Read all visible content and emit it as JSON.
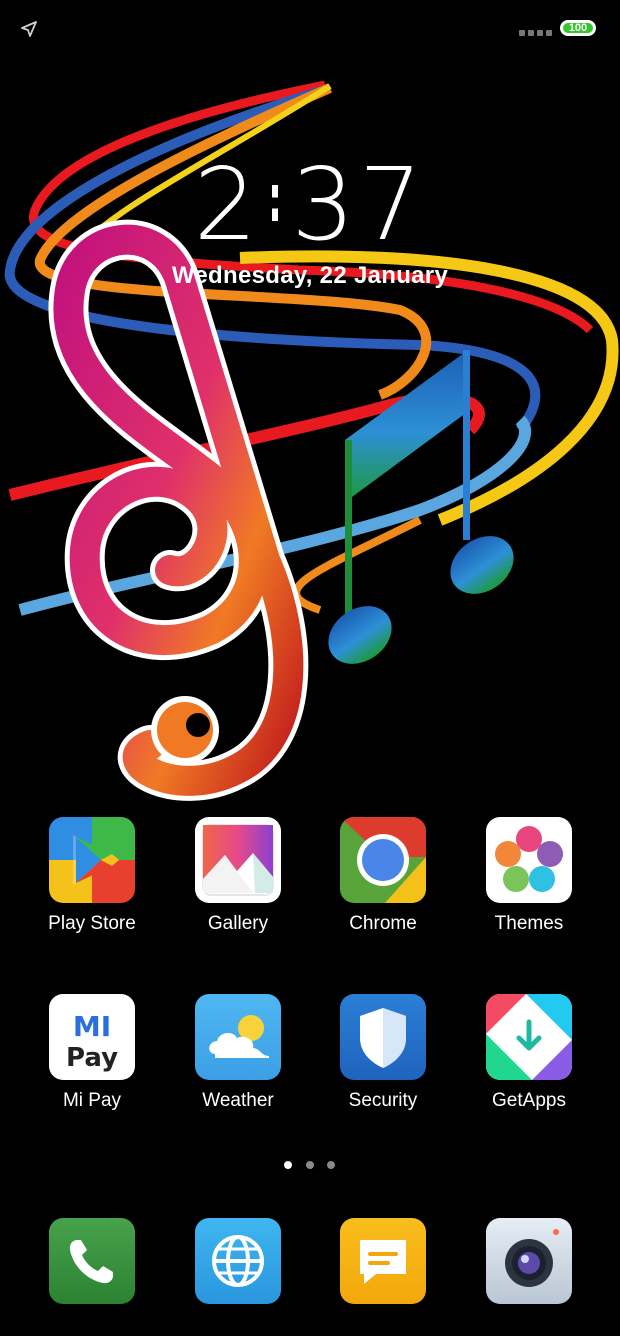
{
  "status_bar": {
    "location_icon": "location-arrow-icon",
    "battery_level": 100,
    "battery_text": "100",
    "battery_color": "#35c52d"
  },
  "lock_clock": {
    "hours": "2",
    "minutes": "37",
    "date": "Wednesday, 22 January"
  },
  "apps_row1": [
    {
      "label": "Play Store",
      "icon": "play-store-icon"
    },
    {
      "label": "Gallery",
      "icon": "gallery-icon"
    },
    {
      "label": "Chrome",
      "icon": "chrome-icon"
    },
    {
      "label": "Themes",
      "icon": "themes-icon"
    }
  ],
  "apps_row2": [
    {
      "label": "Mi Pay",
      "icon": "mi-pay-icon",
      "icon_text_top": "MI",
      "icon_text_bottom": "Pay"
    },
    {
      "label": "Weather",
      "icon": "weather-icon"
    },
    {
      "label": "Security",
      "icon": "security-icon"
    },
    {
      "label": "GetApps",
      "icon": "getapps-icon"
    }
  ],
  "page_indicator": {
    "pages": 3,
    "current": 1
  },
  "dock": [
    {
      "icon": "phone-icon"
    },
    {
      "icon": "browser-globe-icon"
    },
    {
      "icon": "messages-icon"
    },
    {
      "icon": "camera-icon"
    }
  ],
  "wallpaper": "music-notes-wallpaper"
}
